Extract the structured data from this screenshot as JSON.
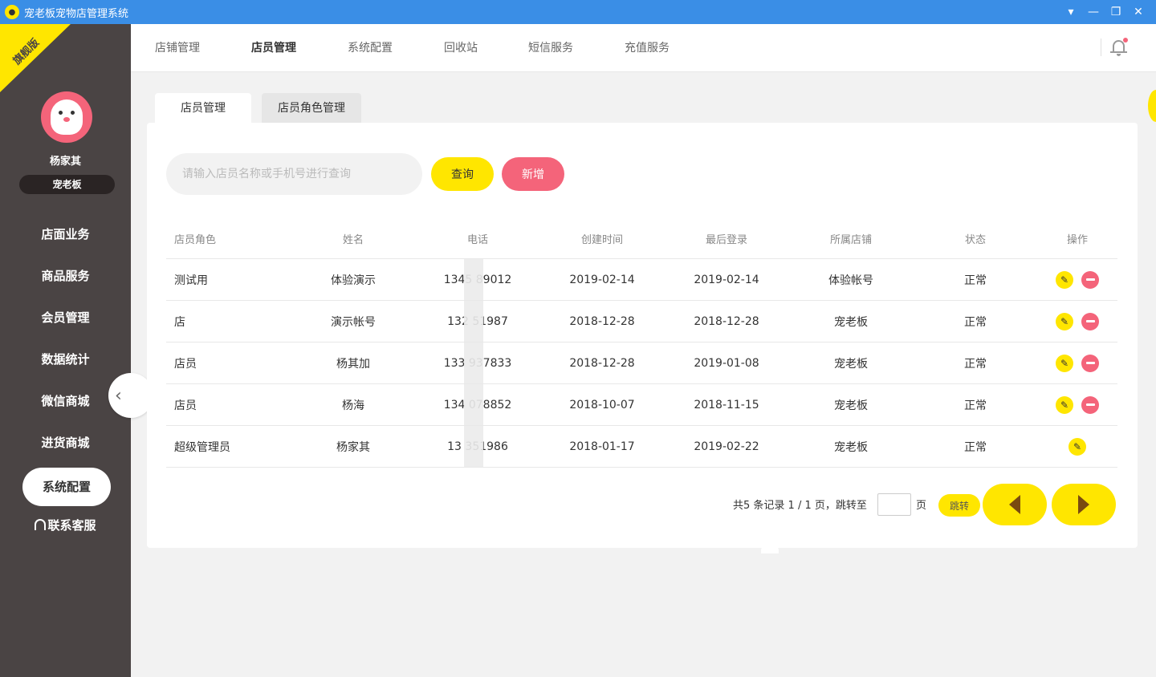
{
  "window": {
    "title": "宠老板宠物店管理系统",
    "controls": [
      "▾",
      "—",
      "❐",
      "✕"
    ]
  },
  "sidebar": {
    "ribbon": "旗舰版",
    "username": "杨家其",
    "shop_name": "宠老板",
    "items": [
      {
        "label": "店面业务"
      },
      {
        "label": "商品服务"
      },
      {
        "label": "会员管理"
      },
      {
        "label": "数据统计"
      },
      {
        "label": "微信商城"
      },
      {
        "label": "进货商城"
      },
      {
        "label": "系统配置"
      }
    ],
    "support": "联系客服",
    "collapse_icon": "‹"
  },
  "topnav": {
    "tabs": [
      {
        "label": "店铺管理"
      },
      {
        "label": "店员管理"
      },
      {
        "label": "系统配置"
      },
      {
        "label": "回收站"
      },
      {
        "label": "短信服务"
      },
      {
        "label": "充值服务"
      }
    ],
    "active": "店员管理"
  },
  "subtabs": [
    {
      "label": "店员管理"
    },
    {
      "label": "店员角色管理"
    }
  ],
  "search": {
    "placeholder": "请输入店员名称或手机号进行查询",
    "value": "",
    "query_label": "查询",
    "add_label": "新增"
  },
  "table": {
    "columns": [
      "店员角色",
      "姓名",
      "电话",
      "创建时间",
      "最后登录",
      "所属店铺",
      "状态",
      "操作"
    ],
    "rows": [
      {
        "role": "测试用",
        "name": "体验演示",
        "phone": "1345   89012",
        "created": "2019-02-14",
        "last_login": "2019-02-14",
        "shop": "体验帐号",
        "status": "正常",
        "deletable": true
      },
      {
        "role": "店",
        "name": "演示帐号",
        "phone": "132   51987",
        "created": "2018-12-28",
        "last_login": "2018-12-28",
        "shop": "宠老板",
        "status": "正常",
        "deletable": true
      },
      {
        "role": "店员",
        "name": "杨其加",
        "phone": "133   937833",
        "created": "2018-12-28",
        "last_login": "2019-01-08",
        "shop": "宠老板",
        "status": "正常",
        "deletable": true
      },
      {
        "role": "店员",
        "name": "杨海",
        "phone": "134   078852",
        "created": "2018-10-07",
        "last_login": "2018-11-15",
        "shop": "宠老板",
        "status": "正常",
        "deletable": true
      },
      {
        "role": "超级管理员",
        "name": "杨家其",
        "phone": "13   351986",
        "created": "2018-01-17",
        "last_login": "2019-02-22",
        "shop": "宠老板",
        "status": "正常",
        "deletable": false
      }
    ]
  },
  "pager": {
    "summary": "共5 条记录 1 / 1 页，跳转至",
    "unit": "页",
    "jump_label": "跳转",
    "page_input": ""
  },
  "colors": {
    "accent_yellow": "#ffe600",
    "accent_pink": "#f4647a",
    "sidebar_bg": "#4a4444",
    "titlebar_bg": "#3a8ee6"
  }
}
